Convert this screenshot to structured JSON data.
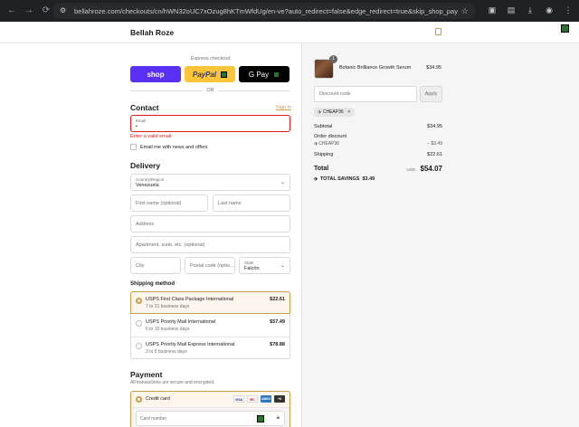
{
  "browser": {
    "url": "bellahroze.com/checkouts/cn/hWN32oUC7xOzug8hKTmWfdUg/en-ve?auto_redirect=false&edge_redirect=true&skip_shop_pay=true",
    "back_icon": "arrow-left-icon",
    "forward_icon": "arrow-right-icon",
    "reload_icon": "reload-icon"
  },
  "header": {
    "brand": "Bellah Roze"
  },
  "express": {
    "label": "Express checkout",
    "shop_label": "shop",
    "paypal_label": "PayPal",
    "gpay_label": "G Pay",
    "or_label": "OR"
  },
  "contact": {
    "title": "Contact",
    "signin": "Sign in",
    "email_label": "Email",
    "email_value": "•",
    "error": "Enter a valid email",
    "newsletter": "Email me with news and offers"
  },
  "delivery": {
    "title": "Delivery",
    "country_label": "Country/Region",
    "country_value": "Venezuela",
    "first_name_ph": "First name (optional)",
    "last_name_ph": "Last name",
    "address_ph": "Address",
    "apartment_ph": "Apartment, suite, etc. (optional)",
    "city_ph": "City",
    "postal_ph": "Postal code (optio...",
    "state_label": "State",
    "state_value": "Falcón"
  },
  "shipping": {
    "title": "Shipping method",
    "options": [
      {
        "name": "USPS First Class Package International",
        "time": "7 to 21 business days",
        "price": "$22.61",
        "selected": true
      },
      {
        "name": "USPS Priority Mail International",
        "time": "6 to 10 business days",
        "price": "$57.49",
        "selected": false
      },
      {
        "name": "USPS Priority Mail Express International",
        "time": "3 to 5 business days",
        "price": "$78.88",
        "selected": false
      }
    ]
  },
  "payment": {
    "title": "Payment",
    "subtitle": "All transactions are secure and encrypted.",
    "method": "Credit card",
    "card_logos": [
      "VISA",
      "MC",
      "AMEX",
      "+6"
    ],
    "card_number_ph": "Card number"
  },
  "summary": {
    "qty": "1",
    "product_name": "Botanic Brilliance Growth Serum",
    "product_price": "$34.95",
    "discount_ph": "Discount code",
    "apply": "Apply",
    "tag": "CHEAP36",
    "subtotal_label": "Subtotal",
    "subtotal": "$34.95",
    "order_discount_label": "Order discount",
    "discount_code": "CHEAP36",
    "discount_value": "− $3.49",
    "shipping_label": "Shipping",
    "shipping_value": "$22.61",
    "total_label": "Total",
    "currency": "USD",
    "total": "$54.07",
    "savings_label": "TOTAL SAVINGS",
    "savings_value": "$3.49"
  },
  "colors": {
    "accent": "#c99b4a",
    "error": "#dd1d1d",
    "shop": "#5a31f4",
    "paypal": "#ffc439"
  }
}
